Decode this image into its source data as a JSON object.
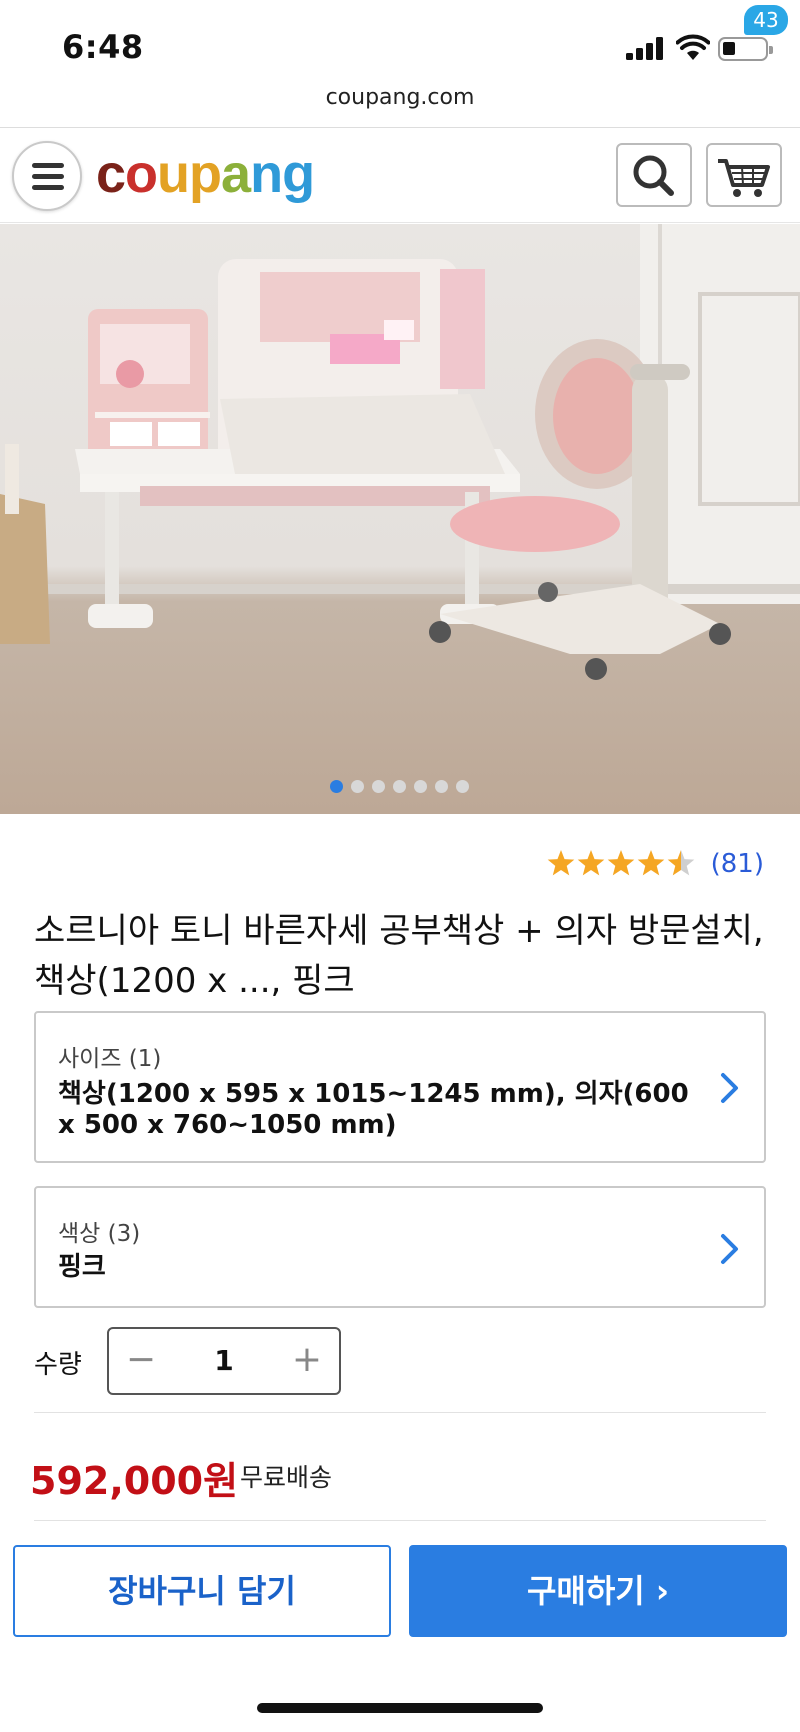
{
  "status_bar": {
    "time": "6:48"
  },
  "browser": {
    "url": "coupang.com"
  },
  "header": {
    "logo_parts": [
      "c",
      "o",
      "u",
      "p",
      "a",
      "n",
      "g"
    ],
    "cart_count": "43"
  },
  "gallery": {
    "image_count": 7,
    "active_index": 0
  },
  "product": {
    "rating_value": 4.5,
    "rating_max": 5,
    "review_count": "(81)",
    "title": "소르니아 토니 바른자세 공부책상 + 의자 방문설치, 책상(1200 x ..., 핑크"
  },
  "options": {
    "size": {
      "label": "사이즈 (1)",
      "value": "책상(1200 x 595 x 1015~1245 mm), 의자(600 x 500 x 760~1050 mm)"
    },
    "color": {
      "label": "색상 (3)",
      "value": "핑크"
    }
  },
  "quantity": {
    "label": "수량",
    "value": "1",
    "minus": "−",
    "plus": "+"
  },
  "pricing": {
    "price": "592,000원",
    "shipping": "무료배송"
  },
  "actions": {
    "add_to_cart": "장바구니 담기",
    "buy_now": "구매하기 ›"
  },
  "colors": {
    "accent_blue": "#2a7de1",
    "price_red": "#c20f16",
    "badge_blue": "#2aa7e6",
    "star_gold": "#f5a623"
  }
}
